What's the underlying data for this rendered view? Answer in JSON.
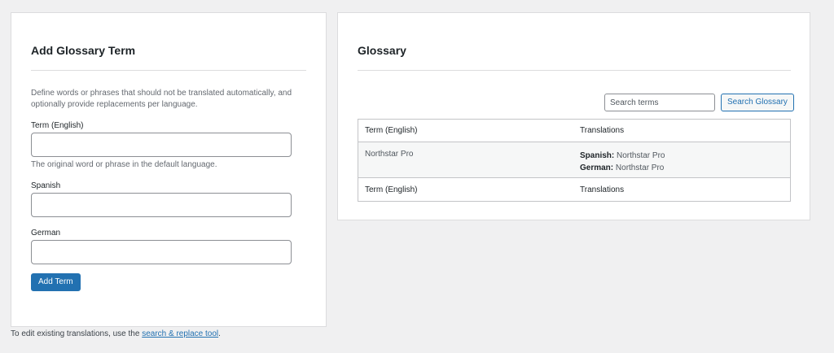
{
  "add_term": {
    "title": "Add Glossary Term",
    "description": "Define words or phrases that should not be translated automatically, and optionally provide replacements per language.",
    "term_label": "Term (English)",
    "term_value": "",
    "term_help": "The original word or phrase in the default language.",
    "spanish_label": "Spanish",
    "spanish_value": "",
    "german_label": "German",
    "german_value": "",
    "submit_label": "Add Term"
  },
  "glossary": {
    "title": "Glossary",
    "search_placeholder": "Search terms",
    "search_button_label": "Search Glossary",
    "columns": [
      "Term (English)",
      "Translations"
    ],
    "rows": [
      {
        "term": "Northstar Pro",
        "translations": [
          {
            "language": "Spanish:",
            "value": "Northstar Pro"
          },
          {
            "language": "German:",
            "value": "Northstar Pro"
          }
        ]
      }
    ]
  },
  "footer": {
    "prefix": "To edit existing translations, use the ",
    "link_label": "search & replace tool",
    "suffix": "."
  },
  "colors": {
    "primary": "#2271b1",
    "background": "#f0f0f1",
    "row_alt": "#f6f7f7"
  }
}
